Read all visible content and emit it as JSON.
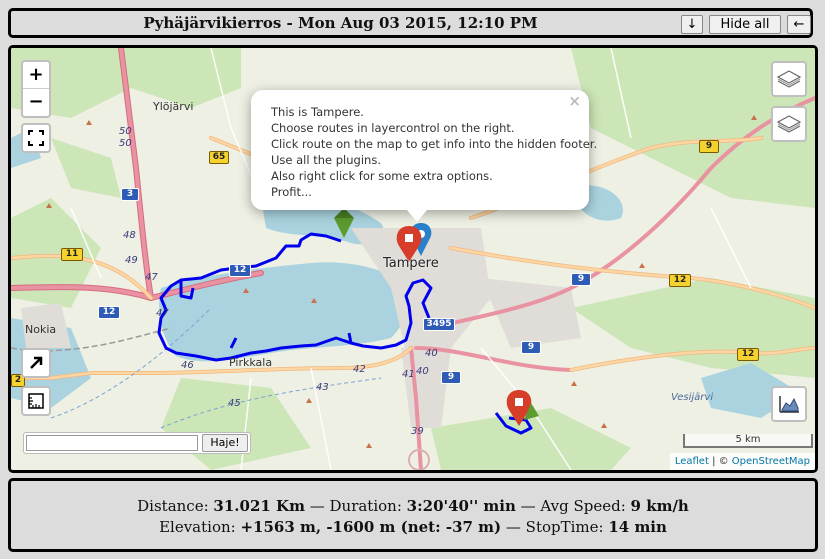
{
  "header": {
    "title": "Pyhäjärvikierros - Mon Aug 03 2015, 12:10 PM",
    "down_label": "↓",
    "hide_all_label": "Hide all",
    "back_label": "←"
  },
  "map": {
    "zoom_in": "+",
    "zoom_out": "−",
    "search_placeholder": "",
    "search_button": "Haje!",
    "scale_label": "5 km",
    "attribution": {
      "leaflet": "Leaflet",
      "separator": " | © ",
      "osm": "OpenStreetMap"
    },
    "popup": {
      "close": "×",
      "lines": [
        "This is Tampere.",
        "Choose routes in layercontrol on the right.",
        "Click route on the map to get info into the hidden footer.",
        "Use all the plugins.",
        "Also right click for some extra options.",
        "Profit..."
      ]
    },
    "places": {
      "tampere": "Tampere",
      "ylojarvi": "Ylöjärvi",
      "nokia": "Nokia",
      "pirkkala": "Pirkkala",
      "vesijarvi": "Vesijärvi"
    },
    "road_numbers": {
      "r65": "65",
      "r3": "3",
      "r11": "11",
      "r12a": "12",
      "r12b": "12",
      "r12c": "12",
      "r12d": "12",
      "r9a": "9",
      "r9b": "9",
      "r9c": "9",
      "r9d": "9",
      "r3495": "3495",
      "r2": "2",
      "n50a": "50",
      "n50b": "50",
      "n48": "48",
      "n49": "49",
      "n47a": "47",
      "n47b": "47",
      "n46": "46",
      "n45": "45",
      "n43": "43",
      "n42": "42",
      "n41": "41",
      "n40a": "40",
      "n40b": "40",
      "n39": "39"
    },
    "colors": {
      "track": "#0000ee",
      "water": "#aad3df",
      "motorway": "#e892a2",
      "primary": "#fcd6a4"
    }
  },
  "footer": {
    "distance_label": "Distance: ",
    "distance_value": "31.021 Km",
    "duration_sep": " — Duration: ",
    "duration_value": "3:20'40'' min",
    "speed_sep": " — Avg Speed: ",
    "speed_value": "9 km/h",
    "elevation_label": "Elevation: ",
    "elevation_value": "+1563 m, -1600 m (net: -37 m)",
    "stoptime_sep": " — StopTime: ",
    "stoptime_value": "14 min"
  }
}
